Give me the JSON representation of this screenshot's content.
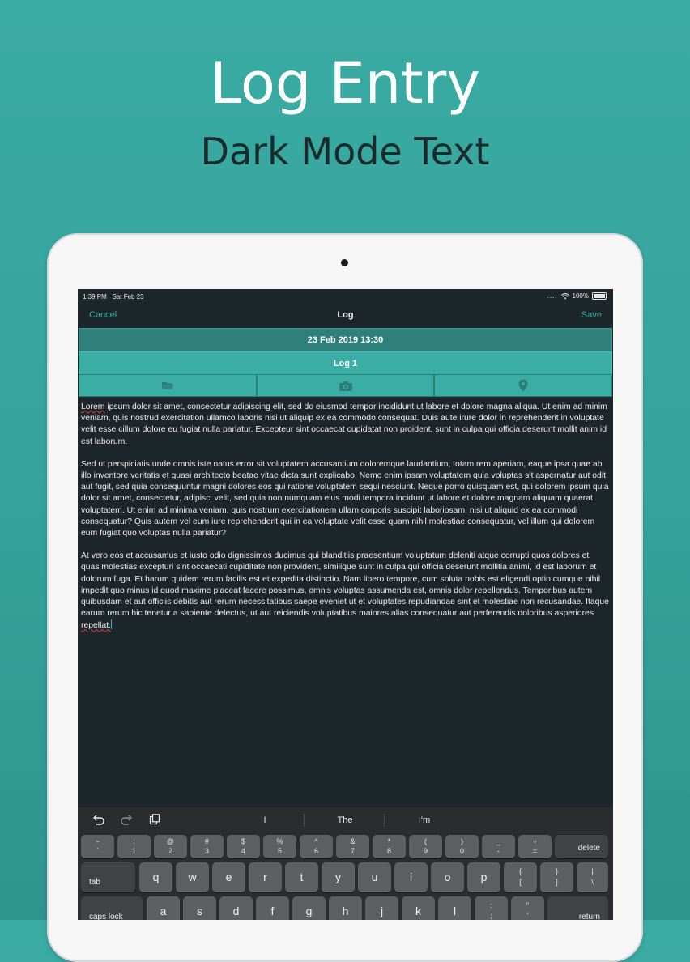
{
  "promo": {
    "title": "Log Entry",
    "subtitle": "Dark Mode Text"
  },
  "status_bar": {
    "time": "1:39 PM",
    "date": "Sat Feb 23",
    "battery": "100%"
  },
  "nav": {
    "cancel": "Cancel",
    "title": "Log",
    "save": "Save"
  },
  "entry": {
    "datetime": "23 Feb 2019 13:30",
    "log_name": "Log 1"
  },
  "toolbar": {
    "icons": [
      "folder-icon",
      "camera-icon",
      "location-pin-icon"
    ]
  },
  "body": {
    "p1_word1": "Lorem",
    "p1_rest": " ipsum dolor sit amet, consectetur adipiscing elit, sed do eiusmod tempor incididunt ut labore et dolore magna aliqua. Ut enim ad minim veniam, quis nostrud exercitation ullamco laboris nisi ut aliquip ex ea commodo consequat. Duis aute irure dolor in reprehenderit in voluptate velit esse cillum dolore eu fugiat nulla pariatur. Excepteur sint occaecat cupidatat non proident, sunt in culpa qui officia deserunt mollit anim id est laborum.",
    "p2": "Sed ut perspiciatis unde omnis iste natus error sit voluptatem accusantium doloremque laudantium, totam rem aperiam, eaque ipsa quae ab illo inventore veritatis et quasi architecto beatae vitae dicta sunt explicabo. Nemo enim ipsam voluptatem quia voluptas sit aspernatur aut odit aut fugit, sed quia consequuntur magni dolores eos qui ratione voluptatem sequi nesciunt. Neque porro quisquam est, qui dolorem ipsum quia dolor sit amet, consectetur, adipisci velit, sed quia non numquam eius modi tempora incidunt ut labore et dolore magnam aliquam quaerat voluptatem. Ut enim ad minima veniam, quis nostrum exercitationem ullam corporis suscipit laboriosam, nisi ut aliquid ex ea commodi consequatur? Quis autem vel eum iure reprehenderit qui in ea voluptate velit esse quam nihil molestiae consequatur, vel illum qui dolorem eum fugiat quo voluptas nulla pariatur?",
    "p3_main": "At vero eos et accusamus et iusto odio dignissimos ducimus qui blanditiis praesentium voluptatum deleniti atque corrupti quos dolores et quas molestias excepturi sint occaecati cupiditate non provident, similique sunt in culpa qui officia deserunt mollitia animi, id est laborum et dolorum fuga. Et harum quidem rerum facilis est et expedita distinctio. Nam libero tempore, cum soluta nobis est eligendi optio cumque nihil impedit quo minus id quod maxime placeat facere possimus, omnis voluptas assumenda est, omnis dolor repellendus. Temporibus autem quibusdam et aut officiis debitis aut rerum necessitatibus saepe eveniet ut et voluptates repudiandae sint et molestiae non recusandae. Itaque earum rerum hic tenetur a sapiente delectus, ut aut reiciendis voluptatibus maiores alias consequatur aut perferendis doloribus asperiores ",
    "p3_last": "repellat."
  },
  "suggestions": [
    "I",
    "The",
    "I'm"
  ],
  "keyboard": {
    "number_row": [
      {
        "top": "~",
        "bot": "`"
      },
      {
        "top": "!",
        "bot": "1"
      },
      {
        "top": "@",
        "bot": "2"
      },
      {
        "top": "#",
        "bot": "3"
      },
      {
        "top": "$",
        "bot": "4"
      },
      {
        "top": "%",
        "bot": "5"
      },
      {
        "top": "^",
        "bot": "6"
      },
      {
        "top": "&",
        "bot": "7"
      },
      {
        "top": "*",
        "bot": "8"
      },
      {
        "top": "(",
        "bot": "9"
      },
      {
        "top": ")",
        "bot": "0"
      },
      {
        "top": "_",
        "bot": "-"
      },
      {
        "top": "+",
        "bot": "="
      }
    ],
    "delete": "delete",
    "tab": "tab",
    "qwerty_row": [
      "q",
      "w",
      "e",
      "r",
      "t",
      "y",
      "u",
      "i",
      "o",
      "p"
    ],
    "qwerty_extra": [
      {
        "top": "{",
        "bot": "["
      },
      {
        "top": "}",
        "bot": "]"
      },
      {
        "top": "|",
        "bot": "\\"
      }
    ],
    "caps_lock": "caps lock",
    "home_row": [
      "a",
      "s",
      "d",
      "f",
      "g",
      "h",
      "j",
      "k",
      "l"
    ],
    "home_extra": [
      {
        "top": ":",
        "bot": ";"
      },
      {
        "top": "\"",
        "bot": "'"
      }
    ],
    "return": "return"
  }
}
